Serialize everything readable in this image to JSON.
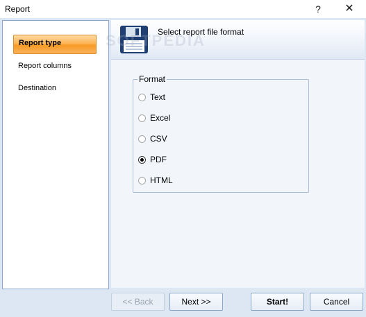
{
  "window": {
    "title": "Report",
    "help_label": "?",
    "close_label": "✕"
  },
  "sidebar": {
    "items": [
      {
        "label": "Report type",
        "active": true
      },
      {
        "label": "Report columns",
        "active": false
      },
      {
        "label": "Destination",
        "active": false
      }
    ]
  },
  "header": {
    "title": "Select report file format",
    "icon": "floppy-disk-icon",
    "watermark": "SOFTPEDIA"
  },
  "format": {
    "legend": "Format",
    "options": [
      {
        "label": "Text",
        "checked": false
      },
      {
        "label": "Excel",
        "checked": false
      },
      {
        "label": "CSV",
        "checked": false
      },
      {
        "label": "PDF",
        "checked": true
      },
      {
        "label": "HTML",
        "checked": false
      }
    ]
  },
  "buttons": {
    "back_label": "<< Back",
    "next_label": "Next >>",
    "start_label": "Start!",
    "cancel_label": "Cancel"
  },
  "colors": {
    "accent": "#f79a26",
    "panel_bg": "#dde7f3",
    "border": "#8aa6c9"
  }
}
